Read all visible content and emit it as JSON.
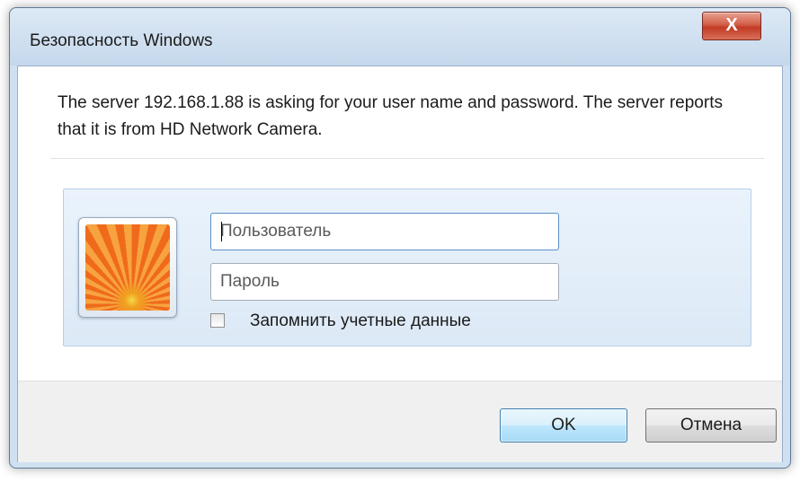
{
  "window": {
    "title": "Безопасность Windows",
    "close_label": "X"
  },
  "message": "The server 192.168.1.88 is asking for your user name and password. The server reports that it is from HD Network Camera.",
  "credentials": {
    "username_placeholder": "Пользователь",
    "password_placeholder": "Пароль",
    "remember_label": "Запомнить учетные данные",
    "remember_checked": false
  },
  "buttons": {
    "ok_label": "OK",
    "cancel_label": "Отмена"
  },
  "icons": {
    "avatar": "user-tile-flower-icon",
    "close": "close-icon"
  }
}
